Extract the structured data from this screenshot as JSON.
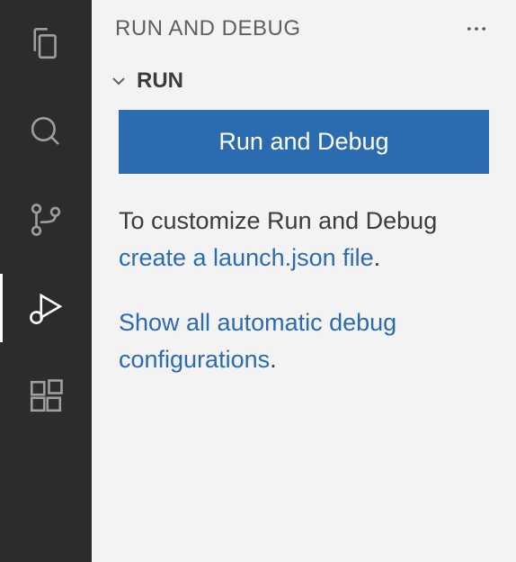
{
  "panel": {
    "title": "RUN AND DEBUG"
  },
  "section": {
    "title": "RUN"
  },
  "run_button_label": "Run and Debug",
  "help": {
    "prefix": "To customize Run and Debug ",
    "link": "create a launch.json file",
    "suffix": "."
  },
  "show_all": {
    "link": "Show all automatic debug configurations",
    "suffix": "."
  }
}
